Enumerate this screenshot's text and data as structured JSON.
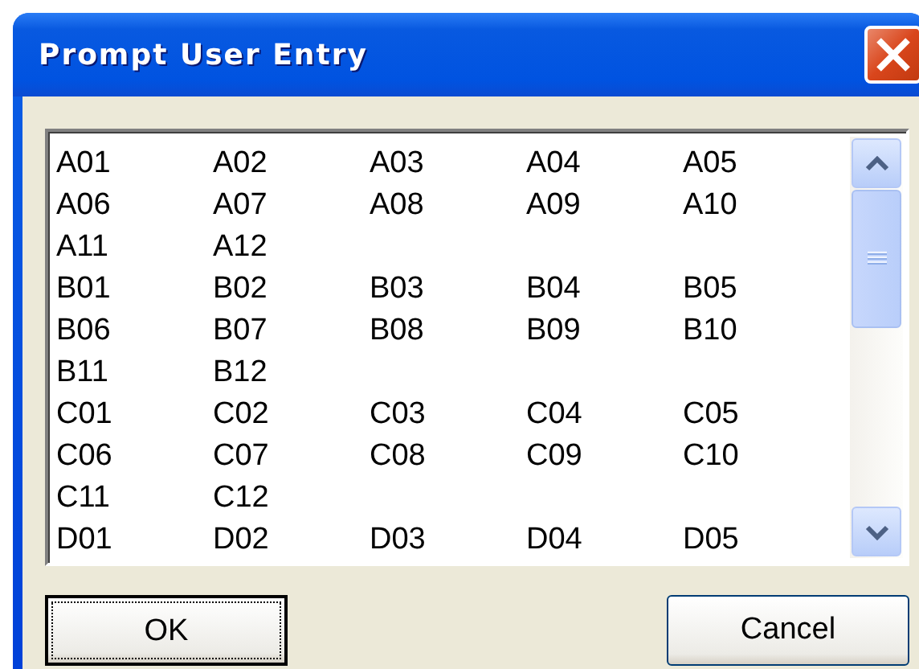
{
  "window": {
    "title": "Prompt User Entry"
  },
  "list": {
    "rows": [
      [
        {
          "label": "A01",
          "selected": false
        },
        {
          "label": "A02",
          "selected": false
        },
        {
          "label": "A03",
          "selected": false
        },
        {
          "label": "A04",
          "selected": false
        },
        {
          "label": "A05",
          "selected": false
        }
      ],
      [
        {
          "label": "A06",
          "selected": false
        },
        {
          "label": "A07",
          "selected": false
        },
        {
          "label": "A08",
          "selected": false
        },
        {
          "label": "A09",
          "selected": false
        },
        {
          "label": "A10",
          "selected": false
        }
      ],
      [
        {
          "label": "A11",
          "selected": false
        },
        {
          "label": "A12",
          "selected": false
        }
      ],
      [
        {
          "label": "B01",
          "selected": false
        },
        {
          "label": "B02",
          "selected": false
        },
        {
          "label": "B03",
          "selected": false
        },
        {
          "label": "B04",
          "selected": false
        },
        {
          "label": "B05",
          "selected": false
        }
      ],
      [
        {
          "label": "B06",
          "selected": false
        },
        {
          "label": "B07",
          "selected": false
        },
        {
          "label": "B08",
          "selected": false
        },
        {
          "label": "B09",
          "selected": false
        },
        {
          "label": "B10",
          "selected": false
        }
      ],
      [
        {
          "label": "B11",
          "selected": false
        },
        {
          "label": "B12",
          "selected": false
        }
      ],
      [
        {
          "label": "C01",
          "selected": false
        },
        {
          "label": "C02",
          "selected": false
        },
        {
          "label": "C03",
          "selected": false
        },
        {
          "label": "C04",
          "selected": false
        },
        {
          "label": "C05",
          "selected": false
        }
      ],
      [
        {
          "label": "C06",
          "selected": false
        },
        {
          "label": "C07",
          "selected": false
        },
        {
          "label": "C08",
          "selected": false
        },
        {
          "label": "C09",
          "selected": false
        },
        {
          "label": "C10",
          "selected": false
        }
      ],
      [
        {
          "label": "C11",
          "selected": false
        },
        {
          "label": "C12",
          "selected": false
        }
      ],
      [
        {
          "label": "D01",
          "selected": false
        },
        {
          "label": "D02",
          "selected": false
        },
        {
          "label": "D03",
          "selected": false
        },
        {
          "label": "D04",
          "selected": false
        },
        {
          "label": "D05",
          "selected": false
        }
      ]
    ]
  },
  "buttons": [
    {
      "label": "OK",
      "focused": true
    },
    {
      "label": "Cancel",
      "focused": false
    }
  ]
}
